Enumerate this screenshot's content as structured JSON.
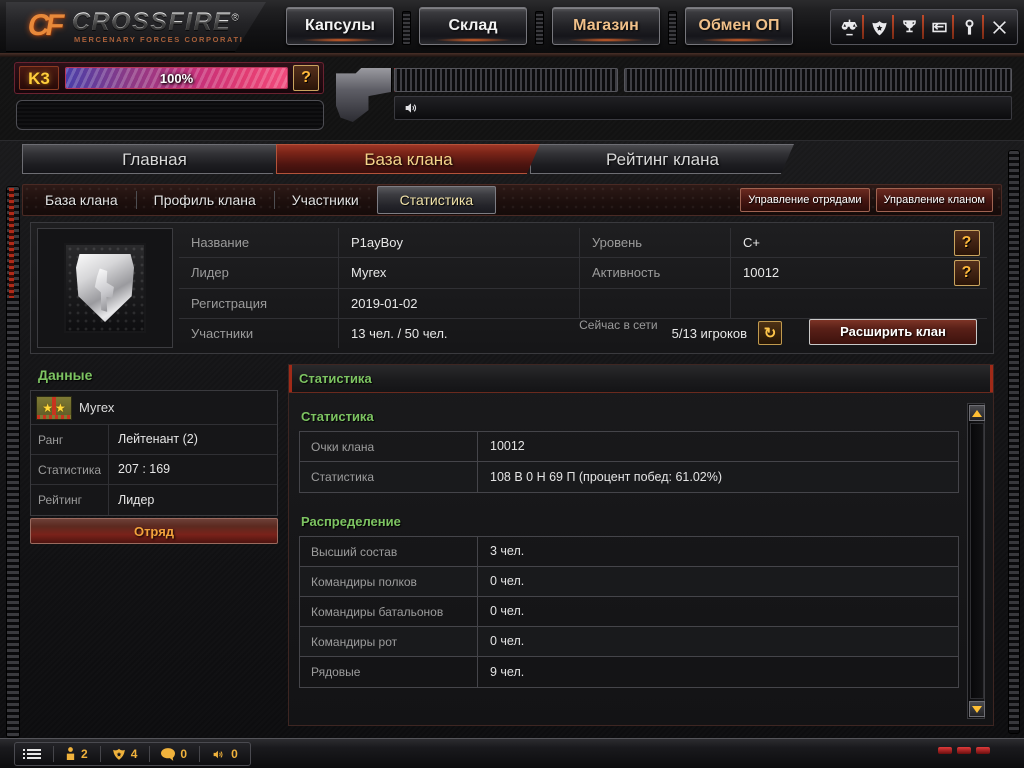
{
  "brand": {
    "logo_mark": "CF",
    "logo_text": "CROSSFIRE",
    "logo_reg": "®",
    "logo_sub": "MERCENARY  FORCES  CORPORATION"
  },
  "topnav": {
    "buttons": [
      {
        "label": "Капсулы",
        "warm": false
      },
      {
        "label": "Склад",
        "warm": false
      },
      {
        "label": "Магазин",
        "warm": true
      },
      {
        "label": "Обмен ОП",
        "warm": true
      }
    ],
    "tray_icons": [
      "scales-icon",
      "badge-star-icon",
      "trophy-icon",
      "return-arrow-icon",
      "wrench-icon",
      "close-icon"
    ]
  },
  "gauge": {
    "k3_tag": "K3",
    "k3_percent": "100%",
    "k3_help": "?",
    "volume_icon": "speaker-icon"
  },
  "maintabs": [
    {
      "label": "Главная",
      "active": false
    },
    {
      "label": "База клана",
      "active": true
    },
    {
      "label": "Рейтинг клана",
      "active": false
    }
  ],
  "subtabs": [
    {
      "label": "База клана",
      "active": false
    },
    {
      "label": "Профиль клана",
      "active": false
    },
    {
      "label": "Участники",
      "active": false
    },
    {
      "label": "Статистика",
      "active": true
    }
  ],
  "manage_buttons": [
    {
      "label": "Управление отрядами"
    },
    {
      "label": "Управление кланом"
    }
  ],
  "clan_info": {
    "emblem_name": "clan-emblem-shield",
    "name_label": "Название",
    "name_value": "P1ayBoy",
    "leader_label": "Лидер",
    "leader_value": "Мугех",
    "reg_label": "Регистрация",
    "reg_value": "2019-01-02",
    "members_label": "Участники",
    "members_value": "13 чел. / 50 чел.",
    "level_label": "Уровень",
    "level_value": "C+",
    "activity_label": "Активность",
    "activity_value": "10012",
    "help_mark": "?",
    "online_label": "Сейчас в сети",
    "online_value": "5/13 игроков",
    "refresh_icon": "↻",
    "expand_button": "Расширить клан"
  },
  "left_panel": {
    "title": "Данные",
    "member_name": "Мугех",
    "rows": [
      {
        "label": "Ранг",
        "value": "Лейтенант (2)"
      },
      {
        "label": "Статистика",
        "value": "207 : 169"
      },
      {
        "label": "Рейтинг",
        "value": "Лидер"
      }
    ],
    "squad_button": "Отряд"
  },
  "right_panel": {
    "header": "Статистика",
    "stats_title": "Статистика",
    "stats_rows": [
      {
        "label": "Очки клана",
        "value": "10012"
      },
      {
        "label": "Статистика",
        "value": "108 В 0 Н 69 П (процент побед: 61.02%)"
      }
    ],
    "dist_title": "Распределение",
    "dist_rows": [
      {
        "label": "Высший состав",
        "value": "3 чел."
      },
      {
        "label": "Командиры полков",
        "value": "0 чел."
      },
      {
        "label": "Командиры батальонов",
        "value": "0 чел."
      },
      {
        "label": "Командиры рот",
        "value": "0 чел."
      },
      {
        "label": "Рядовые",
        "value": "9 чел."
      }
    ]
  },
  "statusbar": {
    "menu_icon": "list-menu-icon",
    "items": [
      {
        "icon": "person-icon",
        "count": "2"
      },
      {
        "icon": "clan-shield-icon",
        "count": "4"
      },
      {
        "icon": "chat-bubble-icon",
        "count": "0"
      },
      {
        "icon": "speaker-icon",
        "count": "0"
      }
    ]
  },
  "colors": {
    "accent_red": "#a02a18",
    "accent_green": "#7dc462",
    "accent_gold": "#f0b23c",
    "active_tab": "#f0e2a8"
  }
}
